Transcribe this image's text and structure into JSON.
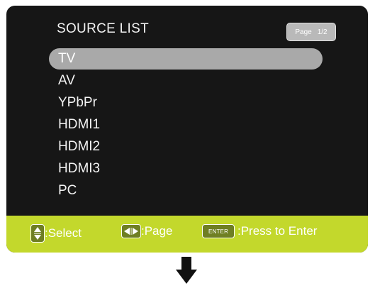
{
  "osd": {
    "title": "SOURCE LIST",
    "page_badge": {
      "label": "Page",
      "value": "1/2"
    },
    "items": [
      {
        "label": "TV",
        "selected": true
      },
      {
        "label": "AV",
        "selected": false
      },
      {
        "label": "YPbPr",
        "selected": false
      },
      {
        "label": "HDMI1",
        "selected": false
      },
      {
        "label": "HDMI2",
        "selected": false
      },
      {
        "label": "HDMI3",
        "selected": false
      },
      {
        "label": "PC",
        "selected": false
      }
    ],
    "footer": {
      "select_label": ":Select",
      "page_label": ":Page",
      "enter_key": "ENTER",
      "enter_label": ":Press to Enter"
    }
  },
  "icons": {
    "select": "up-down-arrows-icon",
    "page": "left-right-arrows-icon",
    "next": "down-arrow-icon"
  },
  "colors": {
    "panel": "#161616",
    "selection": "#a9a9a9",
    "footer": "#c3d82c",
    "text": "#f2f2f2"
  }
}
